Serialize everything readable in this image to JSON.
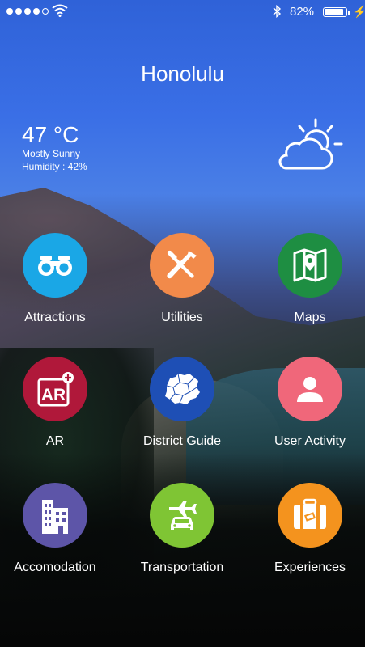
{
  "status_bar": {
    "battery_percent": "82%",
    "charging_icon": "lightning-icon"
  },
  "header": {
    "city": "Honolulu"
  },
  "weather": {
    "temperature": "47 °C",
    "condition": "Mostly Sunny",
    "humidity": "Humidity : 42%",
    "icon": "partly-sunny-icon"
  },
  "menu": {
    "items": [
      {
        "label": "Attractions",
        "icon": "binoculars-icon",
        "color": "#1aa7e6"
      },
      {
        "label": "Utilities",
        "icon": "tools-icon",
        "color": "#f28a4a"
      },
      {
        "label": "Maps",
        "icon": "map-pin-icon",
        "color": "#1e8e42"
      },
      {
        "label": "AR",
        "icon": "ar-icon",
        "color": "#b0183a"
      },
      {
        "label": "District Guide",
        "icon": "district-map-icon",
        "color": "#1e4fb5"
      },
      {
        "label": "User Activity",
        "icon": "user-icon",
        "color": "#f0677a"
      },
      {
        "label": "Accomodation",
        "icon": "building-icon",
        "color": "#5d55a8"
      },
      {
        "label": "Transportation",
        "icon": "plane-car-icon",
        "color": "#7fc534"
      },
      {
        "label": "Experiences",
        "icon": "suitcase-icon",
        "color": "#f4931e"
      }
    ]
  }
}
